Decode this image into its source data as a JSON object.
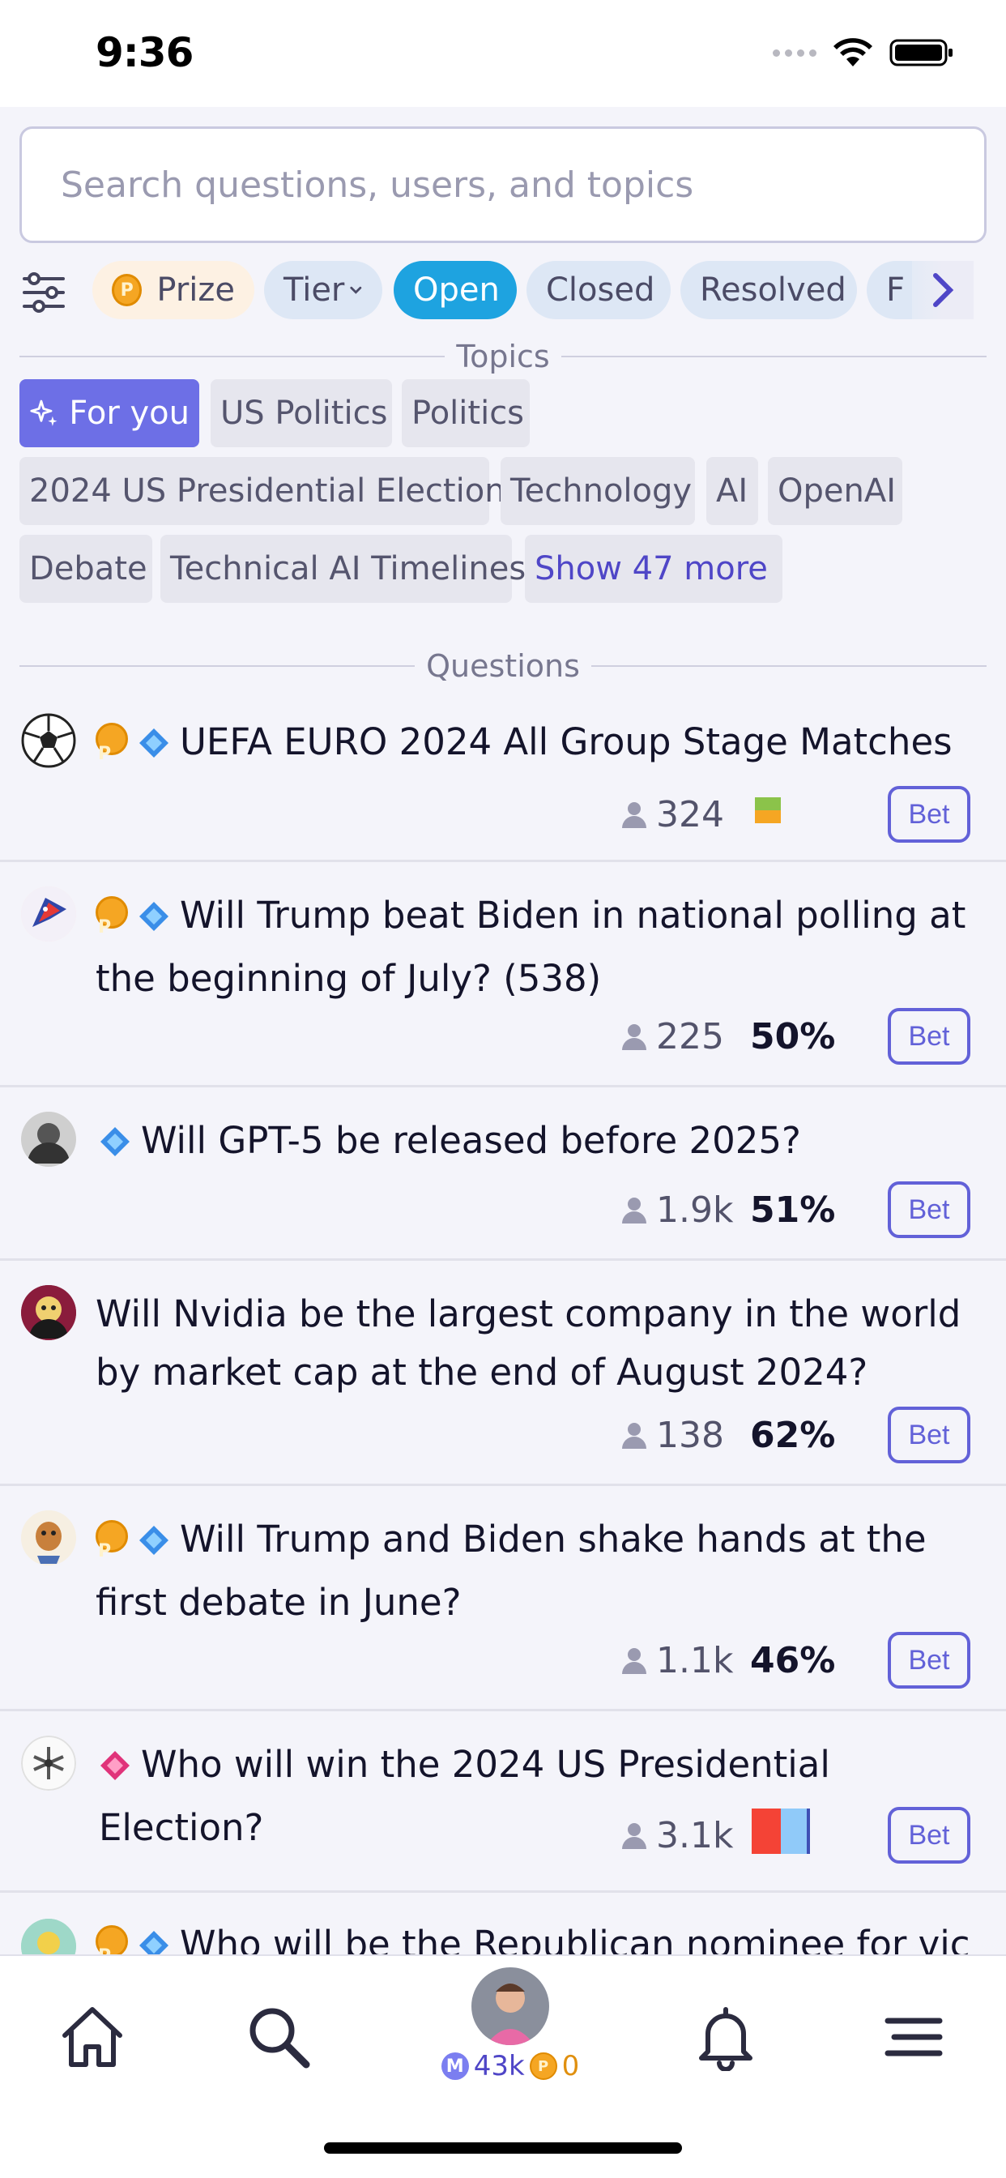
{
  "status_bar": {
    "time": "9:36"
  },
  "search": {
    "placeholder": "Search questions, users, and topics"
  },
  "filters": {
    "chips": [
      {
        "label": "Prize"
      },
      {
        "label": "Tier"
      },
      {
        "label": "Open",
        "active": true
      },
      {
        "label": "Closed"
      },
      {
        "label": "Resolved"
      },
      {
        "label": "F"
      }
    ]
  },
  "sections": {
    "topics": "Topics",
    "questions": "Questions"
  },
  "topics": [
    {
      "label": "For you"
    },
    {
      "label": "US Politics"
    },
    {
      "label": "Politics"
    },
    {
      "label": "2024 US Presidential Election"
    },
    {
      "label": "Technology"
    },
    {
      "label": "AI"
    },
    {
      "label": "OpenAI"
    },
    {
      "label": "Debate"
    },
    {
      "label": "Technical AI Timelines"
    },
    {
      "label": "Show 47 more"
    }
  ],
  "questions": [
    {
      "title": "UEFA EURO 2024 All Group Stage Matches",
      "traders": "324",
      "prob": "",
      "bet": "Bet"
    },
    {
      "title": "Will Trump beat Biden in national polling at the beginning of July? (538)",
      "traders": "225",
      "prob": "50%",
      "bet": "Bet"
    },
    {
      "title": "Will GPT-5 be released before 2025?",
      "traders": "1.9k",
      "prob": "51%",
      "bet": "Bet"
    },
    {
      "title": "Will Nvidia be the largest company in the world by market cap at the end of August 2024?",
      "traders": "138",
      "prob": "62%",
      "bet": "Bet"
    },
    {
      "title": "Will Trump and Biden shake hands at the first debate in June?",
      "traders": "1.1k",
      "prob": "46%",
      "bet": "Bet"
    },
    {
      "title": "Who will win the 2024 US Presidential Election?",
      "traders": "3.1k",
      "prob": "",
      "bet": "Bet"
    },
    {
      "title": "Who will be the Republican nominee for vice"
    }
  ],
  "bottom_nav": {
    "mana_balance": "43k",
    "cash_balance": "0"
  },
  "colors": {
    "accent": "#6261d8",
    "chip_active": "#1ea3e0",
    "prize_coin": "#f5a623"
  }
}
